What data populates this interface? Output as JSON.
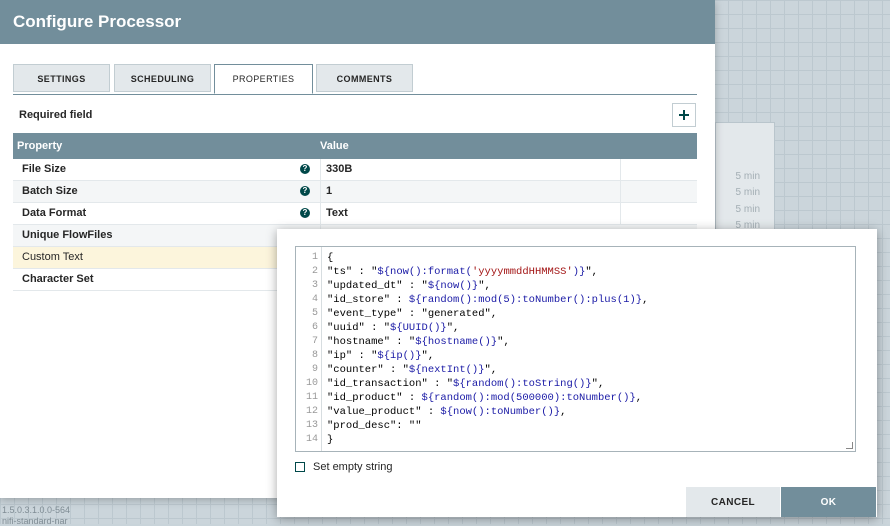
{
  "background": {
    "stats": [
      "5 min",
      "5 min",
      "5 min",
      "5 min"
    ],
    "footer_lines": [
      "1.5.0.3.1.0.0-564",
      "nifi-standard-nar"
    ]
  },
  "dialog": {
    "title": "Configure Processor",
    "tabs": [
      {
        "label": "SETTINGS",
        "active": false
      },
      {
        "label": "SCHEDULING",
        "active": false
      },
      {
        "label": "PROPERTIES",
        "active": true
      },
      {
        "label": "COMMENTS",
        "active": false
      }
    ],
    "required_field_label": "Required field",
    "table": {
      "headers": [
        "Property",
        "Value"
      ],
      "rows": [
        {
          "name": "File Size",
          "value": "330B"
        },
        {
          "name": "Batch Size",
          "value": "1"
        },
        {
          "name": "Data Format",
          "value": "Text"
        },
        {
          "name": "Unique FlowFiles",
          "value": ""
        },
        {
          "name": "Custom Text",
          "value": ""
        },
        {
          "name": "Character Set",
          "value": ""
        }
      ]
    }
  },
  "editor": {
    "lines": [
      "{",
      "\"ts\" : \"${now():format('yyyymmddHHMMSS')}\",",
      "\"updated_dt\" : \"${now()}\",",
      "\"id_store\" : ${random():mod(5):toNumber():plus(1)},",
      "\"event_type\" : \"generated\",",
      "\"uuid\" : \"${UUID()}\",",
      "\"hostname\" : \"${hostname()}\",",
      "\"ip\" : \"${ip()}\",",
      "\"counter\" : \"${nextInt()}\",",
      "\"id_transaction\" : \"${random():toString()}\",",
      "\"id_product\" : ${random():mod(500000):toNumber()},",
      "\"value_product\" : ${now():toNumber()},",
      "\"prod_desc\": \"\"",
      "}"
    ],
    "line_numbers": [
      "1",
      "2",
      "3",
      "4",
      "5",
      "6",
      "7",
      "8",
      "9",
      "10",
      "11",
      "12",
      "13",
      "14"
    ],
    "set_empty_label": "Set empty string",
    "cancel_label": "CANCEL",
    "ok_label": "OK"
  }
}
